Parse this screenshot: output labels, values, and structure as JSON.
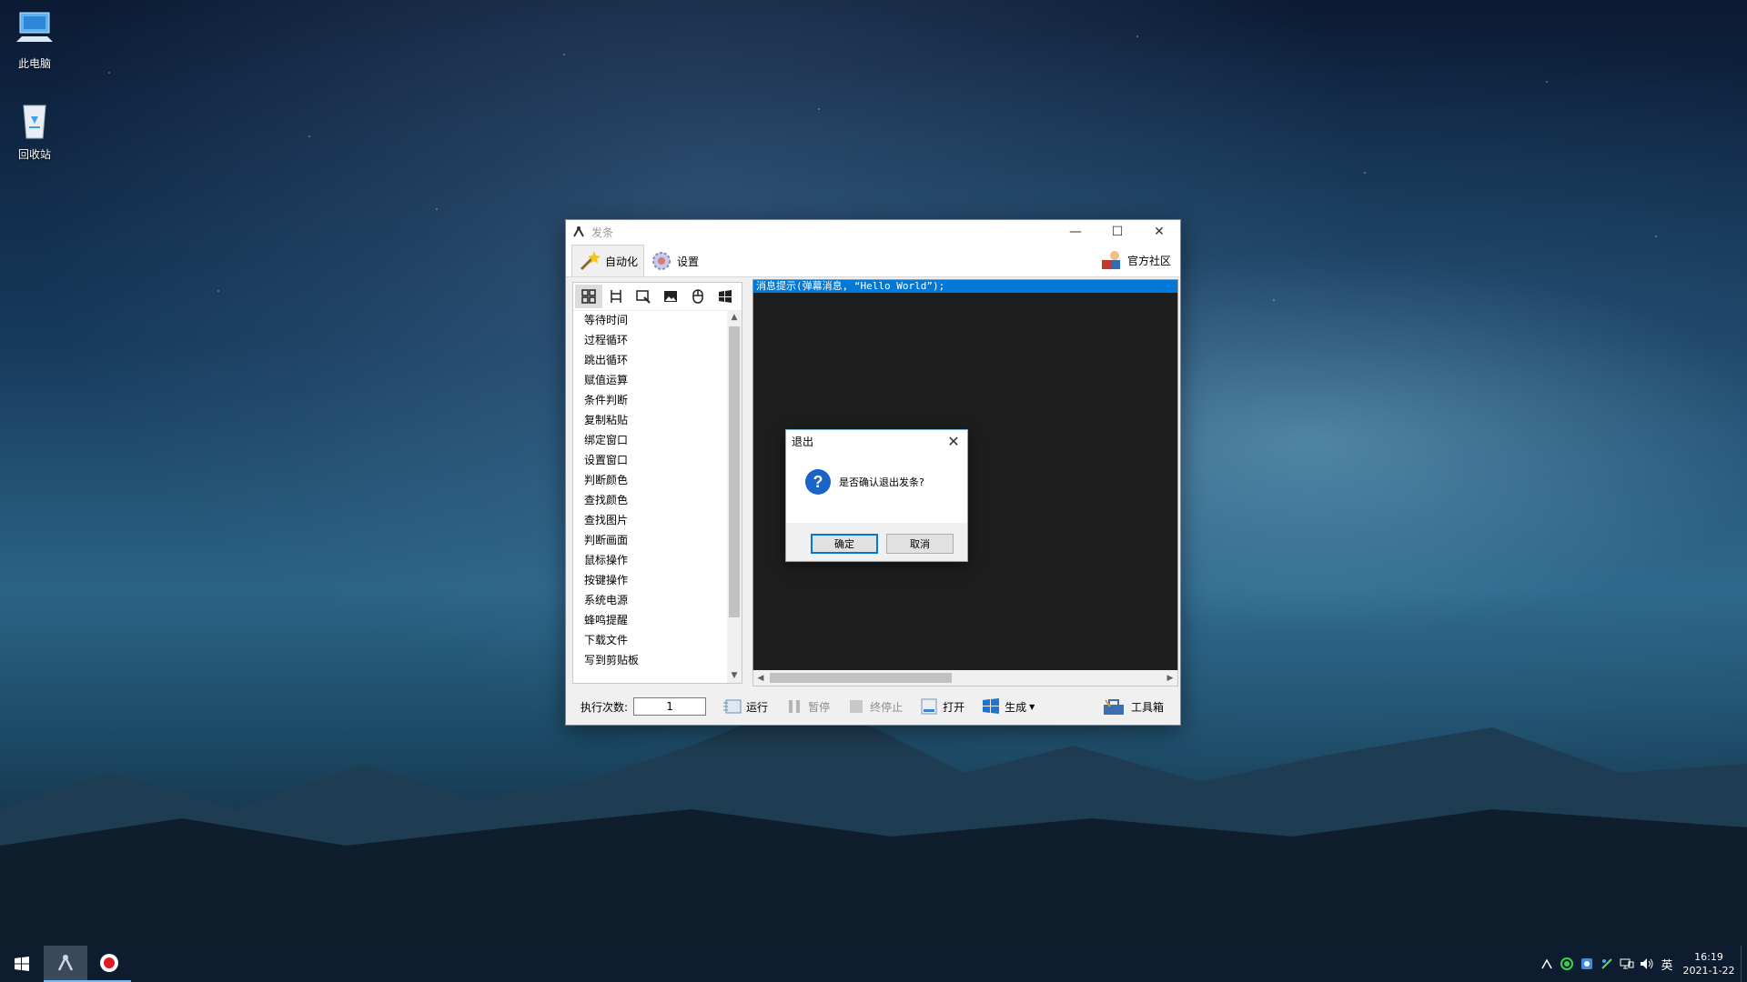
{
  "desktop": {
    "icons": [
      {
        "label": "此电脑",
        "icon": "this-pc-icon"
      },
      {
        "label": "回收站",
        "icon": "recycle-bin-icon"
      }
    ]
  },
  "window": {
    "title": "发条",
    "controls": {
      "minimize": "—",
      "maximize": "☐",
      "close": "✕"
    },
    "tabs": [
      {
        "label": "自动化",
        "icon": "magic-wand-icon",
        "active": true
      },
      {
        "label": "设置",
        "icon": "gear-icon",
        "active": false
      }
    ],
    "community_label": "官方社区",
    "toolbar_icons": [
      "grid-icon",
      "flow-icon",
      "window-select-icon",
      "image-icon",
      "mouse-icon",
      "windows-icon"
    ],
    "commands": [
      "等待时间",
      "过程循环",
      "跳出循环",
      "赋值运算",
      "条件判断",
      "复制粘贴",
      "绑定窗口",
      "设置窗口",
      "判断颜色",
      "查找颜色",
      "查找图片",
      "判断画面",
      "鼠标操作",
      "按键操作",
      "系统电源",
      "蜂鸣提醒",
      "下载文件",
      "写到剪贴板"
    ],
    "code_lines": [
      "消息提示(弹幕消息, “Hello World”);"
    ],
    "bottom": {
      "exec_count_label": "执行次数:",
      "exec_count_value": "1",
      "run_label": "运行",
      "pause_label": "暂停",
      "stop_label": "终停止",
      "open_label": "打开",
      "generate_label": "生成",
      "toolbox_label": "工具箱"
    }
  },
  "dialog": {
    "title": "退出",
    "message": "是否确认退出发条?",
    "ok_label": "确定",
    "cancel_label": "取消"
  },
  "taskbar": {
    "apps": [
      "fatiao-app-icon",
      "record-icon"
    ],
    "tray_icons": [
      "fatiao-tray-icon",
      "green-circle-icon",
      "app-tray-icon",
      "network-share-icon",
      "network-icon",
      "volume-icon"
    ],
    "ime": "英",
    "time": "16:19",
    "date": "2021-1-22"
  },
  "colors": {
    "accent": "#0078d7",
    "editor_bg": "#1e1e1e",
    "taskbar_bg": "#0d1c2e"
  }
}
